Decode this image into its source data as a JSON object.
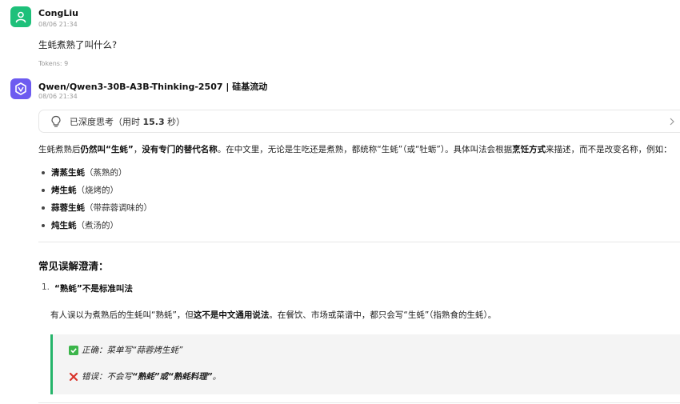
{
  "colors": {
    "user_avatar": "#1ec07a",
    "bot_avatar": "#6d5bf0",
    "quote_accent": "#25b46a"
  },
  "user": {
    "name": "CongLiu",
    "time": "08/06 21:34",
    "message": "生蚝煮熟了叫什么?",
    "tokens": "Tokens: 9",
    "avatar_icon": "person-icon"
  },
  "bot": {
    "name": "Qwen/Qwen3-30B-A3B-Thinking-2507 | 硅基流动",
    "time": "08/06 21:34",
    "avatar_icon": "qwen-logo-icon"
  },
  "thinking": {
    "prefix": "已深度思考（用时 ",
    "duration": "15.3",
    "suffix": " 秒）",
    "icon": "lightbulb-icon",
    "expand_icon": "chevron-right-icon"
  },
  "answer": {
    "p1": "生蚝煮熟后",
    "p2": "仍然叫“生蚝”",
    "p3": "，",
    "p4": "没有专门的替代名称",
    "p5": "。在中文里，无论是生吃还是煮熟，都统称“生蚝”（或“牡蛎”）。具体叫法会根据",
    "p6": "烹饪方式",
    "p7": "来描述，而不是改变名称，例如：",
    "bullets": [
      {
        "bold": "清蒸生蚝",
        "note": "（蒸熟的）"
      },
      {
        "bold": "烤生蚝",
        "note": "（烧烤的）"
      },
      {
        "bold": "蒜蓉生蚝",
        "note": "（带蒜蓉调味的）"
      },
      {
        "bold": "炖生蚝",
        "note": "（煮汤的）"
      }
    ],
    "section_title": "常见误解澄清：",
    "ol_num": "1.",
    "ol_title": "“熟蚝”不是标准叫法",
    "explain1": "有人误以为煮熟后的生蚝叫“熟蚝”，但",
    "explain2": "这不是中文通用说法",
    "explain3": "。在餐饮、市场或菜谱中，都只会写“生蚝”（指熟食的生蚝）。",
    "quote_correct_label": "正确：菜单写“蒜蓉烤生蚝”",
    "quote_wrong_label": "错误：不会写",
    "quote_wrong_value": "“熟蚝”或“熟蚝料理”",
    "quote_wrong_end": "。",
    "correct_icon": "check-mark-icon",
    "wrong_icon": "cross-mark-icon"
  }
}
